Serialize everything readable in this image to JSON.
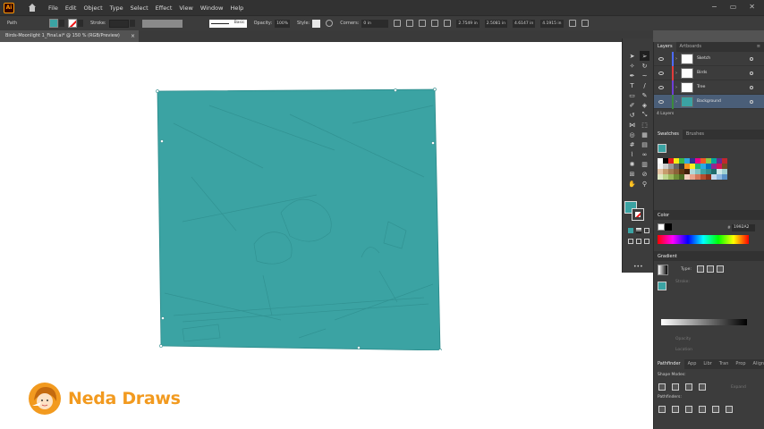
{
  "menubar": {
    "app_icon": "Ai",
    "items": [
      "File",
      "Edit",
      "Object",
      "Type",
      "Select",
      "Effect",
      "View",
      "Window",
      "Help"
    ],
    "window_controls": [
      "−",
      "▭",
      "✕"
    ]
  },
  "controlbar": {
    "selection_label": "Path",
    "stroke_label": "Stroke:",
    "brush_label": "Basic",
    "opacity_label": "Opacity:",
    "opacity_value": "100%",
    "style_label": "Style:",
    "corners_label": "Corners:",
    "corners_value": "0 in",
    "x_value": "2.7549 in",
    "y_value": "2.5081 in",
    "w_value": "4.6147 in",
    "h_value": "4.1915 in"
  },
  "document": {
    "tab_title": "Birds-Moonlight 1_Final.ai* @ 150 % (RGB/Preview)",
    "close_glyph": "×",
    "fill_color": "#3ba3a3"
  },
  "layers_panel": {
    "tabs": [
      "Layers",
      "Artboards"
    ],
    "layers": [
      {
        "name": "Sketch",
        "color": "#4d6bff"
      },
      {
        "name": "Birds",
        "color": "#e03c3c"
      },
      {
        "name": "Tree",
        "color": "#6e3fd6"
      },
      {
        "name": "Background",
        "color": "#3c8a3c"
      }
    ],
    "count": "4 Layers"
  },
  "swatches_panel": {
    "tabs": [
      "Swatches",
      "Brushes"
    ]
  },
  "color_panel": {
    "title": "Color",
    "hex_prefix": "#",
    "hex_value": "1992A2"
  },
  "gradient_panel": {
    "title": "Gradient",
    "type_label": "Type:",
    "stroke_label": "Stroke:",
    "opacity_label": "Opacity",
    "location_label": "Location"
  },
  "pathfinder_panel": {
    "tabs": [
      "Pathfinder",
      "App",
      "Libr",
      "Tran",
      "Prop",
      "Align"
    ],
    "shape_modes_label": "Shape Modes:",
    "pathfinders_label": "Pathfinders:",
    "expand_label": "Expand"
  },
  "watermark": {
    "text": "Neda Draws"
  }
}
